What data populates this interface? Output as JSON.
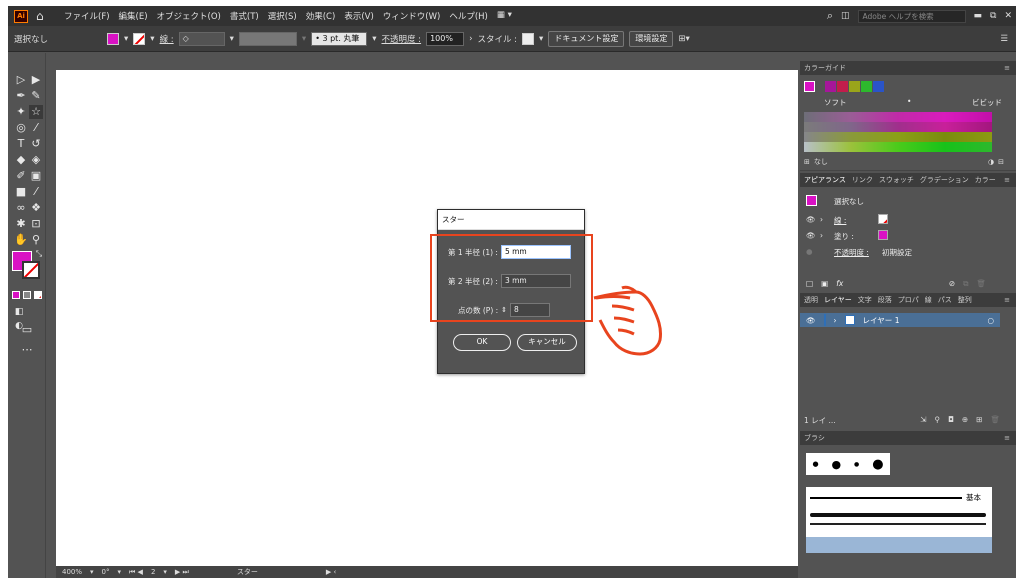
{
  "menubar": {
    "logo": "Ai",
    "items": [
      "ファイル(F)",
      "編集(E)",
      "オブジェクト(O)",
      "書式(T)",
      "選択(S)",
      "効果(C)",
      "表示(V)",
      "ウィンドウ(W)",
      "ヘルプ(H)"
    ],
    "search_placeholder": "Adobe ヘルプを検索"
  },
  "control_bar": {
    "selection": "選択なし",
    "stroke_label": "線 :",
    "brush": "3 pt. 丸筆",
    "opacity_label": "不透明度 :",
    "opacity_value": "100%",
    "style_label": "スタイル :",
    "doc_settings": "ドキュメント設定",
    "prefs": "環境設定"
  },
  "colors": {
    "fill": "#d912c4",
    "accent": "#e8441e",
    "layer_highlight": "#2e6fb8"
  },
  "dialog": {
    "title": "スター",
    "radius1_label": "第 1 半径 (1) :",
    "radius1_value": "5 mm",
    "radius2_label": "第 2 半径 (2) :",
    "radius2_value": "3 mm",
    "points_label": "点の数 (P) :",
    "points_value": "8",
    "ok": "OK",
    "cancel": "キャンセル"
  },
  "color_guide": {
    "tab": "カラーガイド",
    "soft": "ソフト",
    "vivid": "ビビッド",
    "none": "なし"
  },
  "appearance": {
    "tabs": [
      "アピアランス",
      "リンク",
      "スウォッチ",
      "グラデーション",
      "カラー"
    ],
    "selection": "選択なし",
    "stroke": "線 :",
    "fill": "塗り :",
    "opacity": "不透明度 :",
    "opacity_value": "初期設定"
  },
  "layers": {
    "tabs": [
      "透明",
      "レイヤー",
      "文字",
      "段落",
      "プロパ",
      "線",
      "パス",
      "整列"
    ],
    "layer_name": "レイヤー 1",
    "footer": "1 レイ ..."
  },
  "brushes": {
    "tab": "ブラシ",
    "basic": "基本"
  },
  "status": {
    "zoom": "400%",
    "angle": "0°",
    "page": "2",
    "tool": "スター"
  }
}
